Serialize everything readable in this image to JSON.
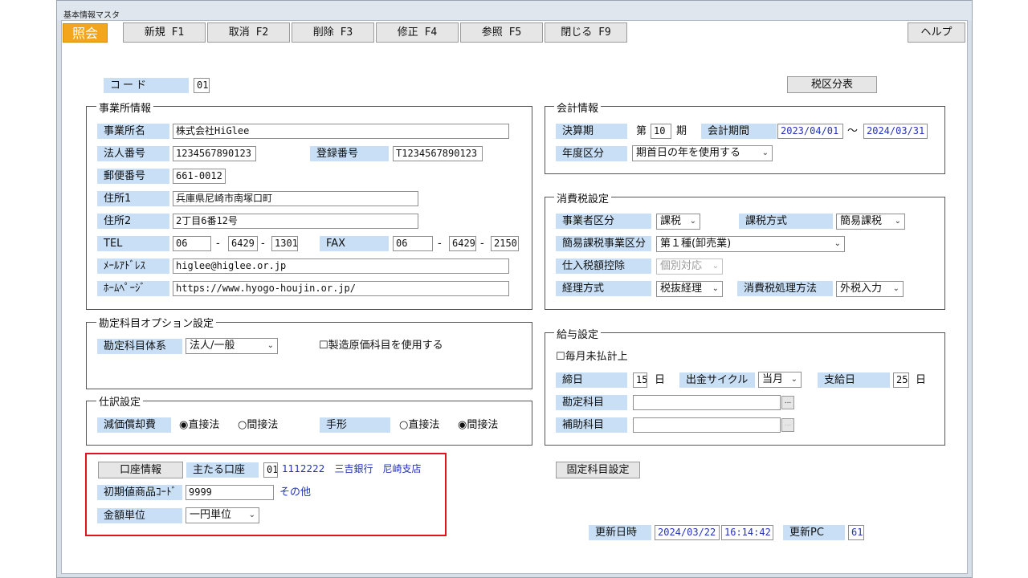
{
  "window": {
    "title": "基本情報マスタ"
  },
  "toolbar": {
    "mode": "照会",
    "new": "新規 F1",
    "cancel": "取消 F2",
    "delete": "削除 F3",
    "edit": "修正 F4",
    "ref": "参照 F5",
    "close": "閉じる F9",
    "help": "ヘルプ"
  },
  "code": {
    "label": "コード",
    "value": "01"
  },
  "tax_table_button": "税区分表",
  "office": {
    "group": "事業所情報",
    "name_label": "事業所名",
    "name": "株式会社HiGlee",
    "corp_no_label": "法人番号",
    "corp_no": "1234567890123",
    "reg_no_label": "登録番号",
    "reg_no": "T1234567890123",
    "zip_label": "郵便番号",
    "zip": "661-0012",
    "addr1_label": "住所1",
    "addr1": "兵庫県尼崎市南塚口町",
    "addr2_label": "住所2",
    "addr2": "2丁目6番12号",
    "tel_label": "TEL",
    "tel1": "06",
    "tel2": "6429",
    "tel3": "1301",
    "fax_label": "FAX",
    "fax1": "06",
    "fax2": "6429",
    "fax3": "2150",
    "dash": "-",
    "mail_label": "ﾒｰﾙｱﾄﾞﾚｽ",
    "mail": "higlee@higlee.or.jp",
    "web_label": "ﾎｰﾑﾍﾟｰｼﾞ",
    "web": "https://www.hyogo-houjin.or.jp/"
  },
  "accounting": {
    "group": "会計情報",
    "fiscal_label": "決算期",
    "dai": "第",
    "period_no": "10",
    "ki": "期",
    "period_label": "会計期間",
    "start": "2023/04/01",
    "tilde": "～",
    "end": "2024/03/31",
    "year_label": "年度区分",
    "year_value": "期首日の年を使用する"
  },
  "tax": {
    "group": "消費税設定",
    "biz_label": "事業者区分",
    "biz_value": "課税",
    "method_label": "課税方式",
    "method_value": "簡易課税",
    "simple_label": "簡易課税事業区分",
    "simple_value": "第１種(卸売業)",
    "deduct_label": "仕入税額控除",
    "deduct_value": "個別対応",
    "acct_label": "経理方式",
    "acct_value": "税抜経理",
    "proc_label": "消費税処理方法",
    "proc_value": "外税入力"
  },
  "subject": {
    "group": "勘定科目オプション設定",
    "system_label": "勘定科目体系",
    "system_value": "法人/一般",
    "mfg_check": "☐製造原価科目を使用する"
  },
  "journal": {
    "group": "仕訳設定",
    "dep_label": "減価償却費",
    "dep_direct": "◉直接法",
    "dep_indirect": "○間接法",
    "bill_label": "手形",
    "bill_direct": "○直接法",
    "bill_indirect": "◉間接法"
  },
  "salary": {
    "group": "給与設定",
    "unpaid_check": "☐毎月未払計上",
    "close_label": "締日",
    "close_day": "15",
    "day": "日",
    "cycle_label": "出金サイクル",
    "cycle_value": "当月",
    "pay_label": "支給日",
    "pay_day": "25",
    "account_label": "勘定科目",
    "sub_label": "補助科目",
    "ellipsis": "..."
  },
  "bank": {
    "info_button": "口座情報",
    "main_label": "主たる口座",
    "main_code": "01",
    "main_value": "1112222　三吉銀行　尼崎支店",
    "init_label": "初期値商品ｺｰﾄﾞ",
    "init_value": "9999",
    "init_other": "その他",
    "unit_label": "金額単位",
    "unit_value": "一円単位"
  },
  "fixed_button": "固定科目設定",
  "update": {
    "date_label": "更新日時",
    "date": "2024/03/22",
    "time": "16:14:42",
    "pc_label": "更新PC",
    "pc": "61"
  }
}
